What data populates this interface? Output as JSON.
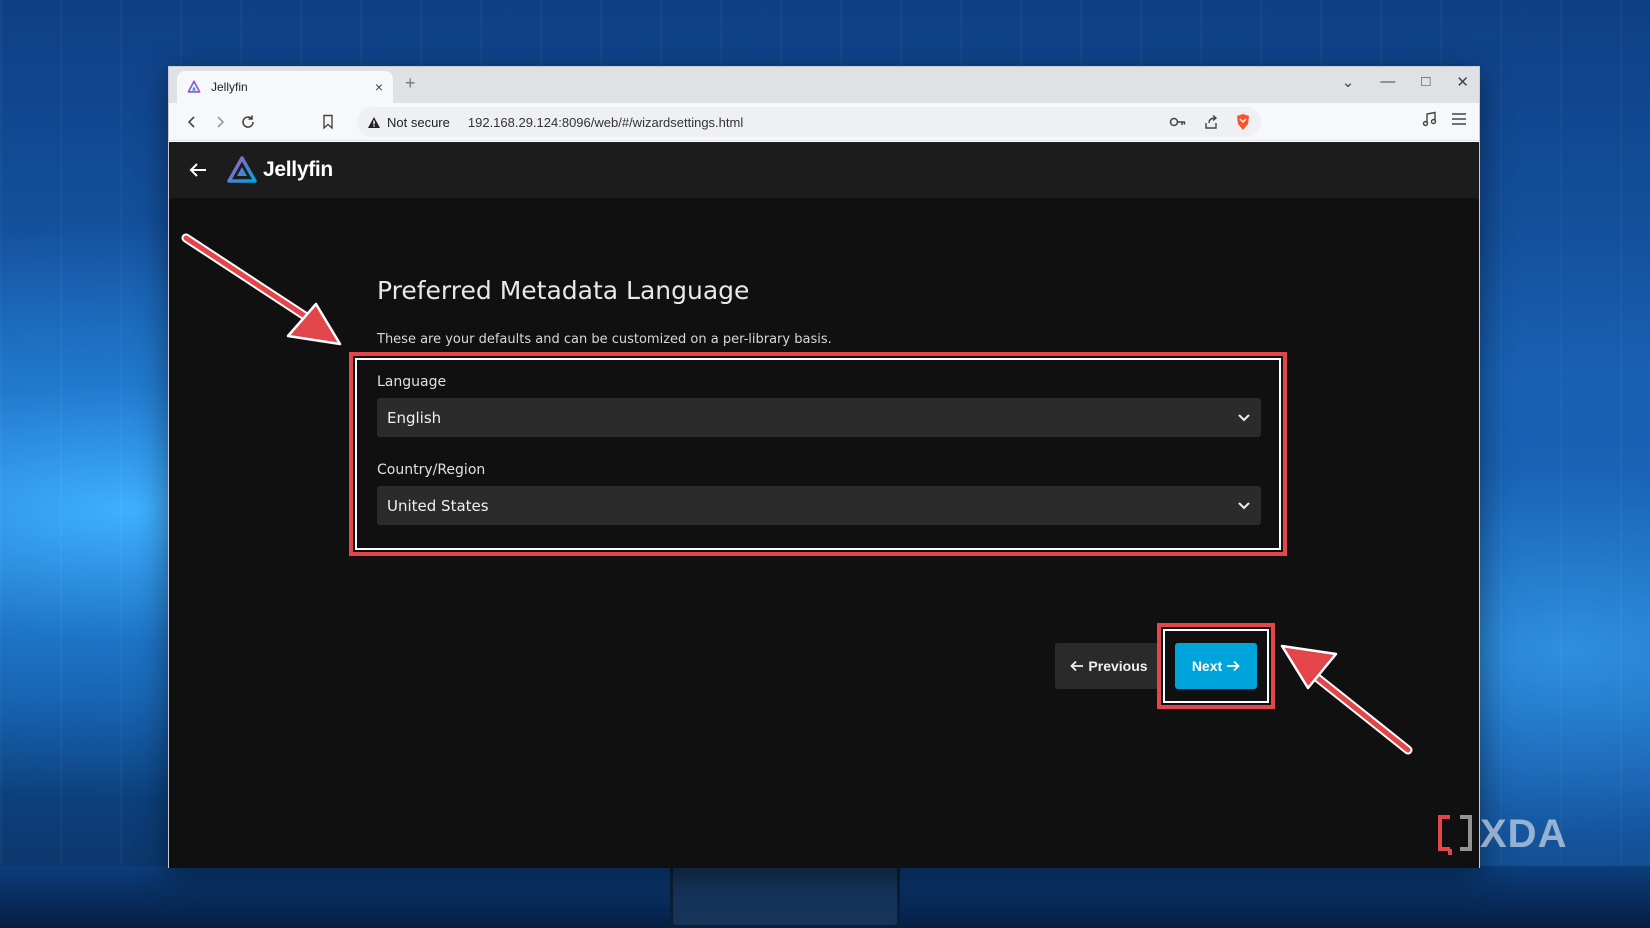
{
  "browser": {
    "tab_title": "Jellyfin",
    "tab_close": "×",
    "new_tab": "+",
    "security_label": "Not secure",
    "url": "192.168.29.124:8096/web/#/wizardsettings.html",
    "window_controls": {
      "dropdown": "⌄",
      "minimize": "—",
      "maximize": "□",
      "close": "✕"
    }
  },
  "app": {
    "logo_text": "Jellyfin"
  },
  "page": {
    "title": "Preferred Metadata Language",
    "description": "These are your defaults and can be customized on a per-library basis."
  },
  "form": {
    "language_label": "Language",
    "language_value": "English",
    "country_label": "Country/Region",
    "country_value": "United States"
  },
  "buttons": {
    "previous": "Previous",
    "next": "Next"
  },
  "watermark": {
    "text": "XDA"
  },
  "colors": {
    "accent": "#00a4dc",
    "annotation": "#e2454a",
    "background": "#101010",
    "header": "#1c1c1c"
  }
}
